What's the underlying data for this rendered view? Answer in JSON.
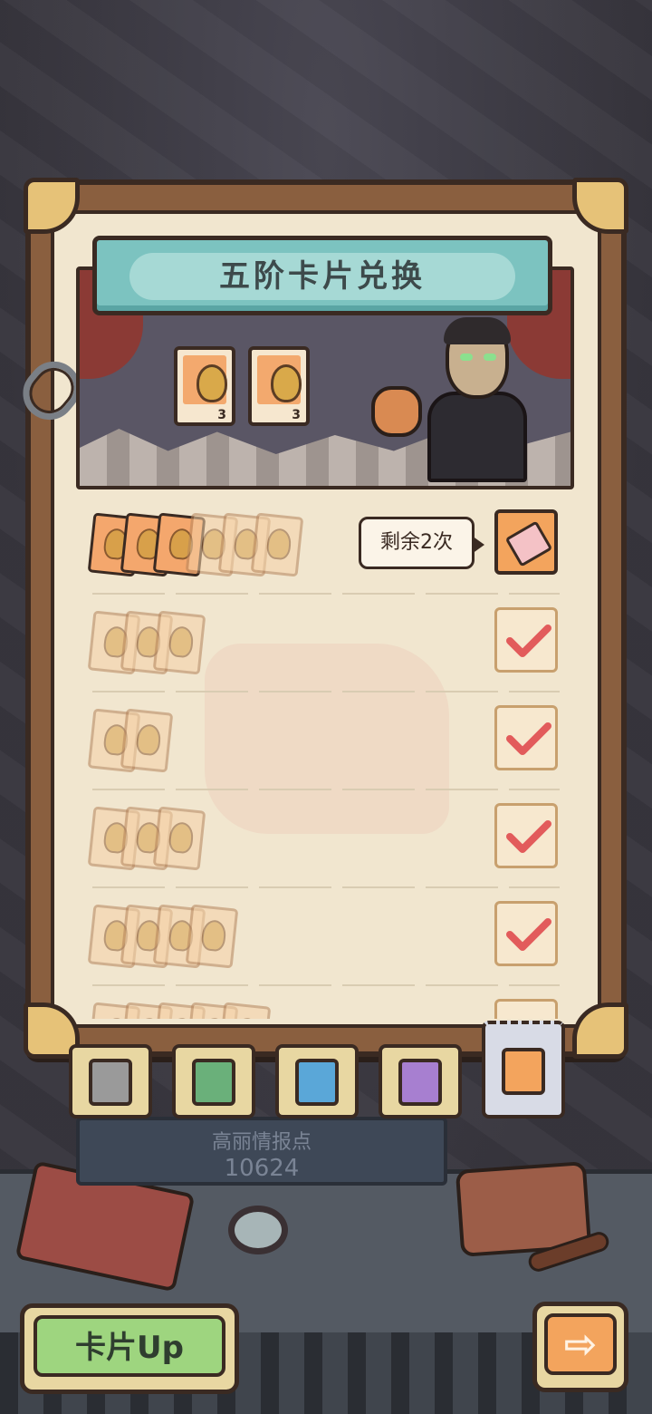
{
  "title": "五阶卡片兑换",
  "scene": {
    "required_cards": [
      {
        "icon": "sack-card-icon",
        "count": "3"
      },
      {
        "icon": "treasure-card-icon",
        "count": "3"
      }
    ]
  },
  "rows": [
    {
      "state": "claimable",
      "tooltip": "剩余2次",
      "reward_icon": "ticket-icon"
    },
    {
      "state": "claimed",
      "reward_icon": "check-icon"
    },
    {
      "state": "claimed",
      "reward_icon": "check-icon"
    },
    {
      "state": "claimed",
      "reward_icon": "check-icon"
    },
    {
      "state": "claimed",
      "reward_icon": "check-icon"
    }
  ],
  "tabs": [
    {
      "name": "grey-tier-tab",
      "color": "#9a9a9a"
    },
    {
      "name": "green-tier-tab",
      "color": "#6ab07a"
    },
    {
      "name": "blue-tier-tab",
      "color": "#5aa7d8"
    },
    {
      "name": "purple-tier-tab",
      "color": "#a77fd0"
    },
    {
      "name": "orange-tier-tab",
      "color": "#f3a45d",
      "selected": true
    }
  ],
  "intel": {
    "label": "高丽情报点",
    "value": "10624"
  },
  "buttons": {
    "card_up": "卡片Up",
    "next_arrow": "⇨"
  },
  "colors": {
    "accent_orange": "#f3a45d",
    "accent_teal": "#7cc3c0",
    "check_red": "#e25b5b"
  }
}
